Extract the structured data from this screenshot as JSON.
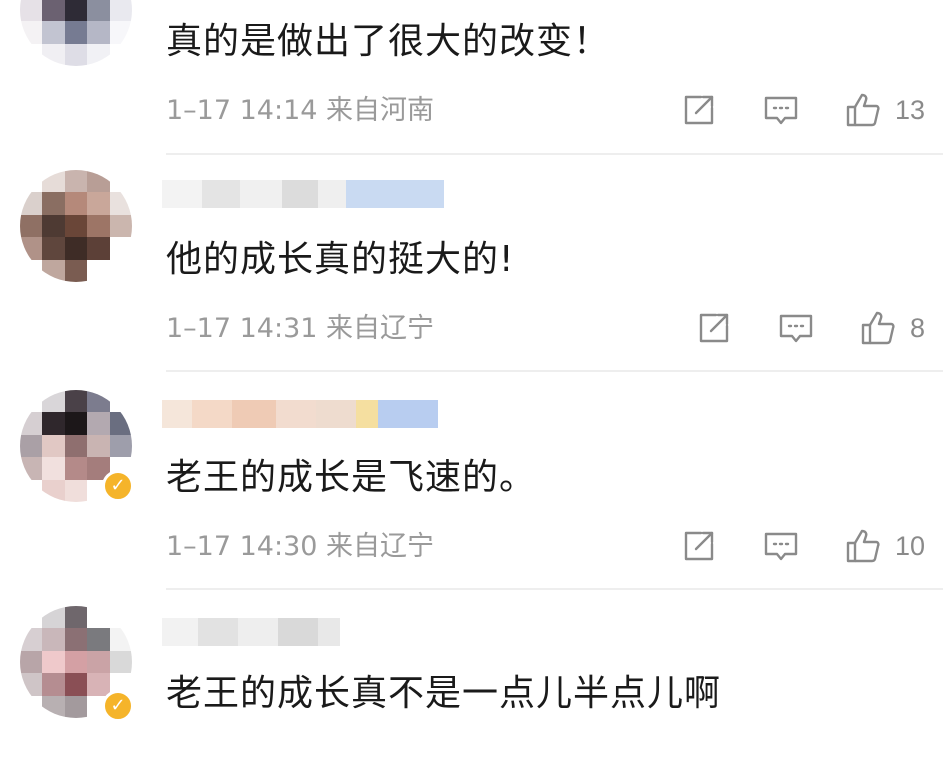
{
  "comments": [
    {
      "text": "真的是做出了很大的改变！",
      "meta": "1–17 14:14  来自河南",
      "likes": "13",
      "verified": false
    },
    {
      "text": "他的成长真的挺大的!",
      "meta": "1–17 14:31  来自辽宁",
      "likes": "8",
      "verified": false
    },
    {
      "text": "老王的成长是飞速的。",
      "meta": "1–17 14:30  来自辽宁",
      "likes": "10",
      "verified": true
    },
    {
      "text": "老王的成长真不是一点儿半点儿啊",
      "meta": "",
      "likes": "",
      "verified": true
    }
  ],
  "icons": {
    "share": "share-icon",
    "reply": "reply-icon",
    "like": "like-icon",
    "verified": "verified-badge-icon"
  },
  "colors": {
    "text": "#1a1a1a",
    "meta": "#9a9a9a",
    "divider": "#eeeeee",
    "verified": "#f5b42a"
  }
}
